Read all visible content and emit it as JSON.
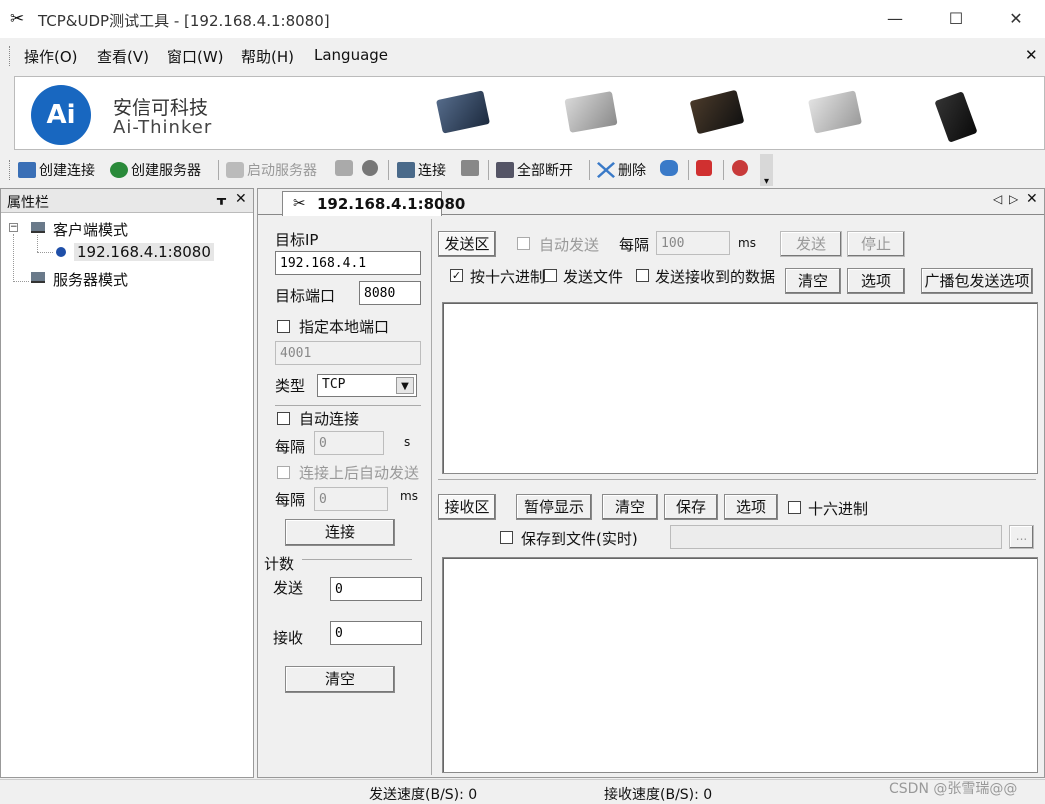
{
  "window": {
    "title": "TCP&UDP测试工具 - [192.168.4.1:8080]"
  },
  "menu": {
    "items": [
      "操作(O)",
      "查看(V)",
      "窗口(W)",
      "帮助(H)",
      "Language"
    ],
    "close": "✕"
  },
  "banner": {
    "brand_cn": "安信可科技",
    "brand_en": "Ai-Thinker",
    "logo_text": "Ai"
  },
  "toolbar": {
    "create_connection": "创建连接",
    "create_server": "创建服务器",
    "start_server": "启动服务器",
    "connect": "连接",
    "disconnect_all": "全部断开",
    "delete": "删除"
  },
  "sidebar": {
    "title": "属性栏",
    "pin": "ᚁ",
    "close": "✕",
    "tree": {
      "client_mode": "客户端模式",
      "connection": "192.168.4.1:8080",
      "server_mode": "服务器模式"
    }
  },
  "tab": {
    "label": "192.168.4.1:8080"
  },
  "connection": {
    "target_ip_label": "目标IP",
    "target_ip": "192.168.4.1",
    "target_port_label": "目标端口",
    "target_port": "8080",
    "local_port_label": "指定本地端口",
    "local_port": "4001",
    "type_label": "类型",
    "type_value": "TCP",
    "auto_connect_label": "自动连接",
    "interval_label": "每隔",
    "interval_value": "0",
    "interval_unit": "s",
    "auto_send_label": "连接上后自动发送",
    "interval2_label": "每隔",
    "interval2_value": "0",
    "interval2_unit": "ms",
    "connect_button": "连接"
  },
  "counter": {
    "title": "计数",
    "send_label": "发送",
    "send_value": "0",
    "recv_label": "接收",
    "recv_value": "0",
    "clear_button": "清空"
  },
  "send": {
    "area_label": "发送区",
    "auto_send": "自动发送",
    "interval_label": "每隔",
    "interval_value": "100",
    "unit": "ms",
    "send_button": "发送",
    "stop_button": "停止",
    "hex_label": "按十六进制",
    "send_file_label": "发送文件",
    "send_received_label": "发送接收到的数据",
    "clear_button": "清空",
    "options_button": "选项",
    "broadcast_button": "广播包发送选项"
  },
  "recv": {
    "area_label": "接收区",
    "pause_button": "暂停显示",
    "clear_button": "清空",
    "save_button": "保存",
    "options_button": "选项",
    "hex_label": "十六进制",
    "save_file_label": "保存到文件(实时)",
    "browse_button": "..."
  },
  "status": {
    "send_speed": "发送速度(B/S): 0",
    "recv_speed": "接收速度(B/S): 0",
    "watermark": "CSDN @张雪瑞@@"
  }
}
